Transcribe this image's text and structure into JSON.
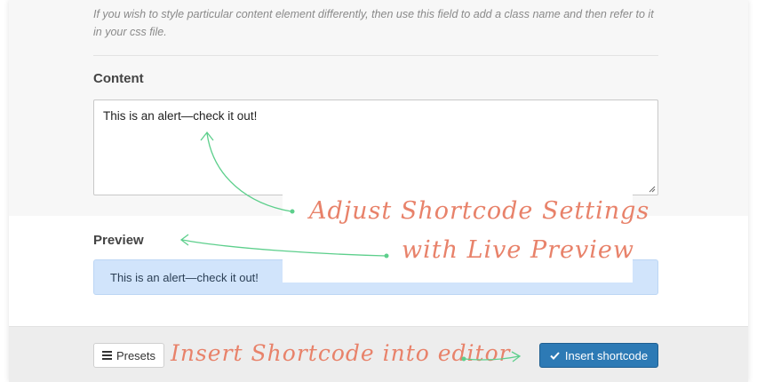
{
  "settings": {
    "css_class_help": "If you wish to style particular content element differently, then use this field to add a class name and then refer to it in your css file.",
    "content_label": "Content",
    "content_value": "This is an alert—check it out!",
    "preview_label": "Preview",
    "preview_alert_text": "This is an alert—check it out!"
  },
  "footer": {
    "presets_label": "Presets",
    "presets_icon": "bars-icon",
    "insert_label": "Insert shortcode",
    "insert_icon": "check-icon"
  },
  "annotations": {
    "line1": "Adjust Shortcode Settings",
    "line2": "with Live Preview",
    "footer_note": "Insert Shortcode into editor"
  },
  "colors": {
    "accent_button": "#2d7ab5",
    "alert_background": "#d1e4fb",
    "annotation_text": "#e8826a",
    "annotation_arrow": "#5dcf8c"
  }
}
